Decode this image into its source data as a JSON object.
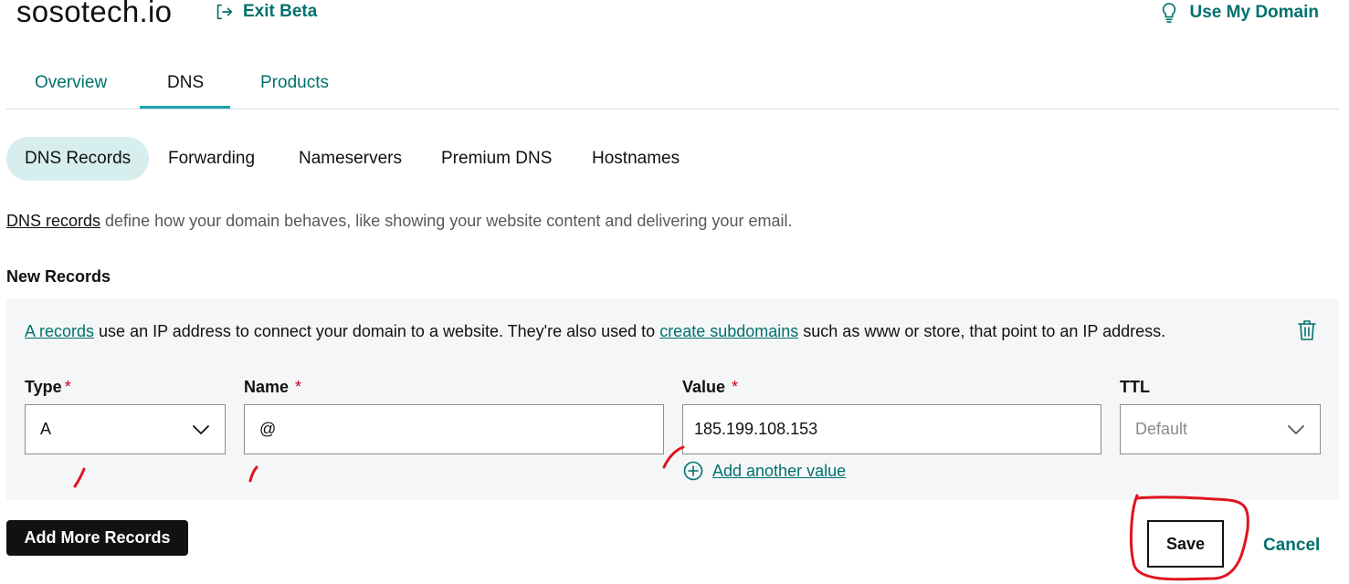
{
  "header": {
    "domain": "sosotech.io",
    "exit_beta": "Exit Beta",
    "use_my_domain": "Use My Domain"
  },
  "main_tabs": [
    {
      "label": "Overview",
      "active": false
    },
    {
      "label": "DNS",
      "active": true
    },
    {
      "label": "Products",
      "active": false
    }
  ],
  "sub_tabs": [
    {
      "label": "DNS Records",
      "active": true
    },
    {
      "label": "Forwarding",
      "active": false
    },
    {
      "label": "Nameservers",
      "active": false
    },
    {
      "label": "Premium DNS",
      "active": false
    },
    {
      "label": "Hostnames",
      "active": false
    }
  ],
  "intro": {
    "link": "DNS records",
    "text": " define how your domain behaves, like showing your website content and delivering your email."
  },
  "new_records": {
    "title": "New Records",
    "description": {
      "link1": "A records",
      "text1": " use an IP address to connect your domain to a website. They're also used to ",
      "link2": "create subdomains",
      "text2": " such as www or store, that point to an IP address."
    },
    "fields": {
      "type": {
        "label": "Type",
        "required": "*",
        "value": "A"
      },
      "name": {
        "label": "Name",
        "required": "*",
        "value": "@"
      },
      "value": {
        "label": "Value",
        "required": "*",
        "value": "185.199.108.153"
      },
      "ttl": {
        "label": "TTL",
        "placeholder": "Default"
      }
    },
    "add_value": "Add another value"
  },
  "actions": {
    "add_more": "Add More Records",
    "save": "Save",
    "cancel": "Cancel"
  },
  "colors": {
    "accent": "#00716e",
    "tab_underline": "#1ba5ab",
    "active_pill": "#d6eeee",
    "panel_bg": "#f5f6f7",
    "required": "#c4001a",
    "annotation": "#e0141e"
  },
  "icons": {
    "exit": "exit-icon",
    "bulb": "lightbulb-icon",
    "trash": "trash-icon",
    "chevron": "chevron-down-icon",
    "plus": "plus-circle-icon"
  }
}
